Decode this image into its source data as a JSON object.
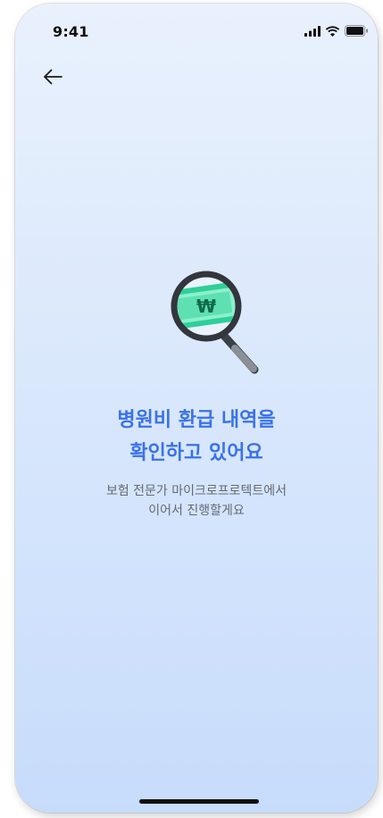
{
  "status_bar": {
    "time": "9:41",
    "icons": [
      "cellular-signal-icon",
      "wifi-icon",
      "battery-icon"
    ]
  },
  "nav": {
    "back_icon": "arrow-left-icon"
  },
  "illustration": {
    "icon": "magnifying-glass-money-icon",
    "banknote_symbol": "₩"
  },
  "main": {
    "title_line1": "병원비 환급 내역을",
    "title_line2": "확인하고 있어요",
    "subtitle_line1": "보험 전문가 마이크로프로텍트에서",
    "subtitle_line2": "이어서 진행할게요"
  },
  "colors": {
    "title": "#3a72e9",
    "subtitle": "#646a75",
    "background_top": "#e9f1fd",
    "background_bottom": "#c7dcfb",
    "banknote": "#2fcf9a"
  }
}
